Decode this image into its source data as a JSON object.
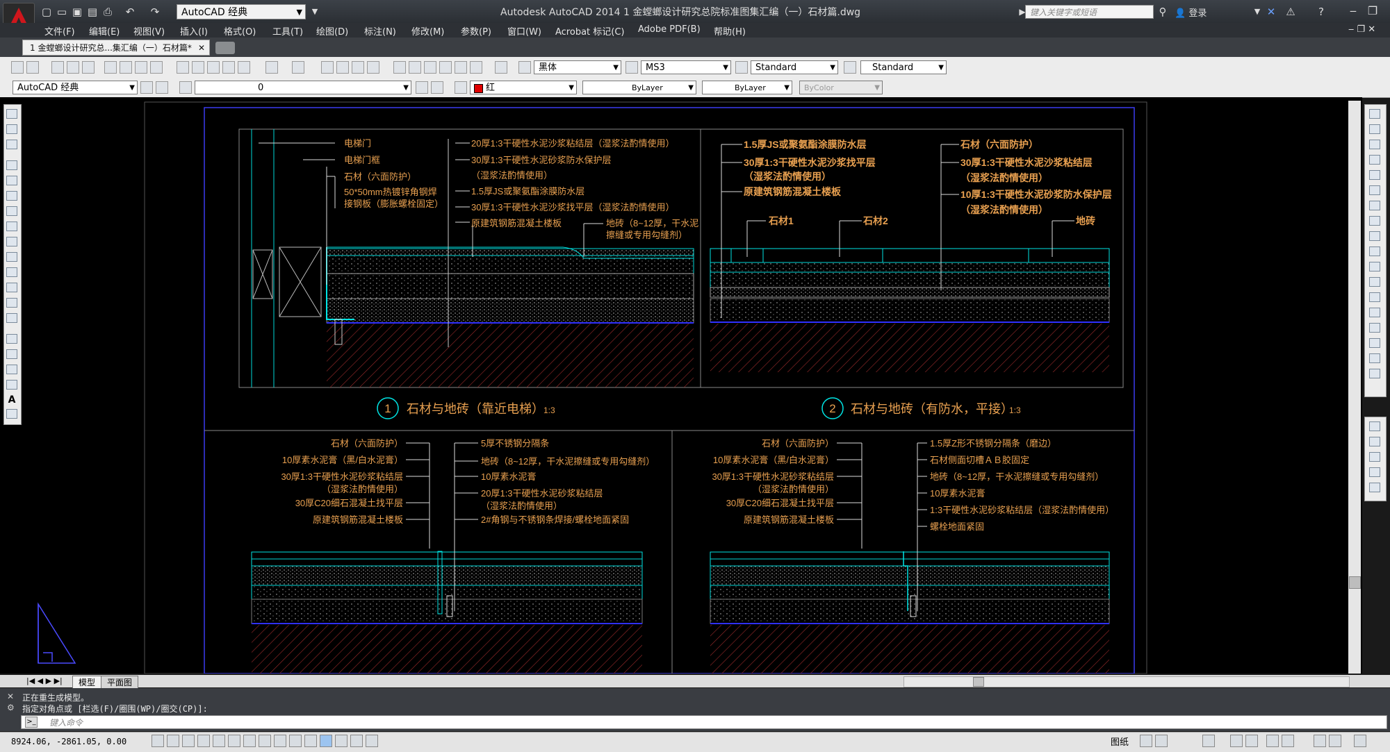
{
  "app": {
    "title": "Autodesk AutoCAD 2014    1 金螳螂设计研究总院标准图集汇编（一）石材篇.dwg",
    "workspace": "AutoCAD 经典",
    "search_placeholder": "键入关键字或短语",
    "login": "登录"
  },
  "menus": [
    "文件(F)",
    "编辑(E)",
    "视图(V)",
    "插入(I)",
    "格式(O)",
    "工具(T)",
    "绘图(D)",
    "标注(N)",
    "修改(M)",
    "参数(P)",
    "窗口(W)",
    "Acrobat 标记(C)",
    "Adobe PDF(B)",
    "帮助(H)"
  ],
  "doc_tab": "1 金螳螂设计研究总...集汇编（一）石材篇*",
  "toolbar": {
    "text_style": "黑体",
    "dim_style": "MS3",
    "table_style": "Standard",
    "mleader_style": "Standard",
    "workspace2": "AutoCAD 经典",
    "layer": "0",
    "color": "红",
    "linetype": "ByLayer",
    "lineweight": "ByLayer",
    "plotstyle": "ByColor"
  },
  "drawing": {
    "d1": {
      "labels_left": [
        "电梯门",
        "电梯门框",
        "石材（六面防护）",
        "50*50mm热镀锌角钢焊",
        "接钢板（膨胀螺栓固定）"
      ],
      "labels_right": [
        "20厚1:3干硬性水泥沙浆粘结层（湿浆法酌情使用）",
        "30厚1:3干硬性水泥砂浆防水保护层",
        "（湿浆法酌情使用）",
        "1.5厚JS或聚氨酯涂膜防水层",
        "30厚1:3干硬性水泥沙浆找平层（湿浆法酌情使用）",
        "原建筑钢筋混凝土楼板",
        "地砖（8~12厚，干水泥",
        "擦缝或专用勾缝剂）"
      ],
      "num": "1",
      "caption": "石材与地砖（靠近电梯）",
      "scale": "1:3"
    },
    "d2": {
      "labels_left": [
        "1.5厚JS或聚氨酯涂膜防水层",
        "30厚1:3干硬性水泥沙浆找平层",
        "（湿浆法酌情使用）",
        "原建筑钢筋混凝土楼板"
      ],
      "labels_right": [
        "石材（六面防护）",
        "30厚1:3干硬性水泥沙浆粘结层",
        "（湿浆法酌情使用）",
        "10厚1:3干硬性水泥砂浆防水保护层",
        "（湿浆法酌情使用）"
      ],
      "tag1": "石材1",
      "tag2": "石材2",
      "tag3": "地砖",
      "num": "2",
      "caption": "石材与地砖（有防水，平接）",
      "scale": "1:3"
    },
    "d3": {
      "labels_left": [
        "石材（六面防护）",
        "10厚素水泥膏（黑/白水泥膏）",
        "30厚1:3干硬性水泥砂浆粘结层",
        "（湿浆法酌情使用）",
        "30厚C20细石混凝土找平层",
        "原建筑钢筋混凝土楼板"
      ],
      "labels_right": [
        "5厚不锈钢分隔条",
        "地砖（8~12厚，干水泥擦缝或专用勾缝剂）",
        "10厚素水泥膏",
        "20厚1:3干硬性水泥砂浆粘结层",
        "（湿浆法酌情使用）",
        "2#角钢与不锈钢条焊接/螺栓地面紧固"
      ]
    },
    "d4": {
      "labels_left": [
        "石材（六面防护）",
        "10厚素水泥膏（黑/白水泥膏）",
        "30厚1:3干硬性水泥砂浆粘结层",
        "（湿浆法酌情使用）",
        "30厚C20细石混凝土找平层",
        "原建筑钢筋混凝土楼板"
      ],
      "labels_right": [
        "1.5厚Z形不锈钢分隔条（磨边）",
        "石材侧面切槽ＡＢ胶固定",
        "地砖（8~12厚，干水泥擦缝或专用勾缝剂）",
        "10厚素水泥膏",
        "1:3干硬性水泥砂浆粘结层（湿浆法酌情使用）",
        "螺栓地面紧固"
      ]
    }
  },
  "layout_tabs": [
    "模型",
    "平面图"
  ],
  "command": {
    "line1": "正在重生成模型。",
    "line2": "指定对角点或 [栏选(F)/圈围(WP)/圈交(CP)]:",
    "input_placeholder": "键入命令"
  },
  "status": {
    "coords": "8924.06, -2861.05, 0.00",
    "paper": "图纸"
  },
  "colors": {
    "label": "#e8a050",
    "cyan": "#00e5e5",
    "blue": "#2020ff",
    "hatch": "#b0b0b0",
    "leader": "#e0e0e0",
    "frame": "#9a9a9a"
  }
}
